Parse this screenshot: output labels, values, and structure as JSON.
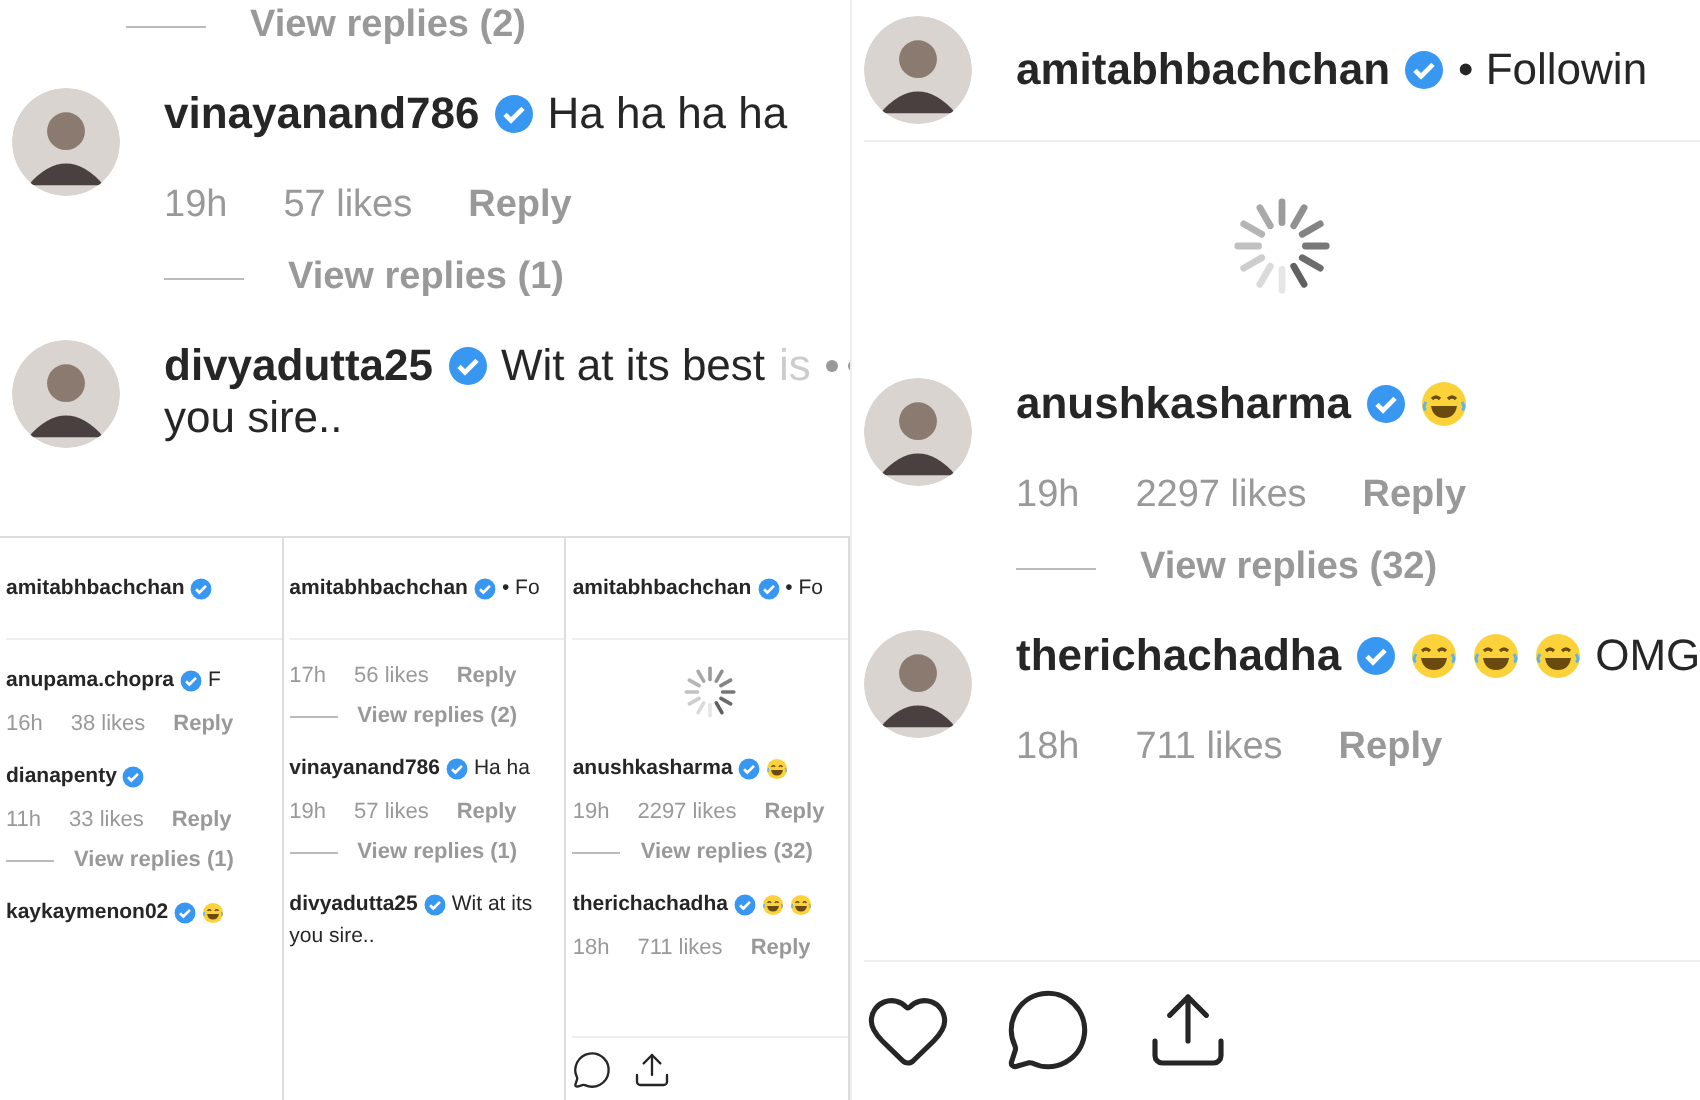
{
  "panels": [
    {
      "kind": "full",
      "lead_replies": "View replies (2)",
      "comments": [
        {
          "username": "vinayanand786",
          "verified": true,
          "avatar": true,
          "text": "Ha ha ha ha",
          "time": "19h",
          "likes": "57 likes",
          "reply": "Reply",
          "view_replies": "View replies (1)"
        },
        {
          "username": "divyadutta25",
          "verified": true,
          "avatar": true,
          "text": "Wit at its best",
          "faded": "is",
          "more": true,
          "text2": "you sire.."
        }
      ]
    },
    {
      "kind": "thumbnail",
      "header": {
        "username": "amitabhbachchan",
        "verified": true
      },
      "comments": [
        {
          "username": "anupama.chopra",
          "verified": true,
          "text": "F",
          "time": "16h",
          "likes": "38 likes",
          "reply": "Reply"
        },
        {
          "username": "dianapenty",
          "verified": true,
          "time": "11h",
          "likes": "33 likes",
          "reply": "Reply",
          "view_replies": "View replies (1)"
        },
        {
          "username": "kaykaymenon02",
          "verified": true,
          "emojis": [
            {
              "kind": "laugh"
            }
          ]
        }
      ]
    },
    {
      "kind": "thumbnail",
      "header": {
        "username": "amitabhbachchan",
        "verified": true,
        "suffix": "• Fo"
      },
      "time": "17h",
      "likes": "56 likes",
      "reply": "Reply",
      "view_replies": "View replies (2)",
      "comments": [
        {
          "username": "vinayanand786",
          "verified": true,
          "text": "Ha ha",
          "time": "19h",
          "likes": "57 likes",
          "reply": "Reply",
          "view_replies": "View replies (1)"
        },
        {
          "username": "divyadutta25",
          "verified": true,
          "text": "Wit at its",
          "text2": "you sire.."
        }
      ]
    },
    {
      "kind": "thumbnail",
      "header": {
        "username": "amitabhbachchan",
        "verified": true,
        "suffix": "• Fo"
      },
      "spinner": true,
      "comments": [
        {
          "username": "anushkasharma",
          "verified": true,
          "emojis": [
            {
              "kind": "laugh"
            }
          ],
          "time": "19h",
          "likes": "2297 likes",
          "reply": "Reply",
          "view_replies": "View replies (32)"
        },
        {
          "username": "therichachadha",
          "verified": true,
          "emojis": [
            {
              "kind": "laugh"
            },
            {
              "kind": "laugh"
            }
          ],
          "time": "18h",
          "likes": "711 likes",
          "reply": "Reply"
        }
      ],
      "actions": [
        {
          "kind": "comment"
        },
        {
          "kind": "share"
        }
      ]
    },
    {
      "kind": "full",
      "header": {
        "username": "amitabhbachchan",
        "verified": true,
        "suffix": "• Followin",
        "avatar": true
      },
      "spinner": true,
      "comments": [
        {
          "username": "anushkasharma",
          "verified": true,
          "avatar": true,
          "emojis": [
            {
              "kind": "laugh"
            }
          ],
          "time": "19h",
          "likes": "2297 likes",
          "reply": "Reply",
          "view_replies": "View replies (32)"
        },
        {
          "username": "therichachadha",
          "verified": true,
          "avatar": true,
          "emojis": [
            {
              "kind": "laugh"
            },
            {
              "kind": "laugh"
            },
            {
              "kind": "laugh"
            }
          ],
          "text": "OMG",
          "time": "18h",
          "likes": "711 likes",
          "reply": "Reply"
        }
      ],
      "actions": [
        {
          "kind": "like"
        },
        {
          "kind": "comment"
        },
        {
          "kind": "share"
        }
      ]
    }
  ]
}
